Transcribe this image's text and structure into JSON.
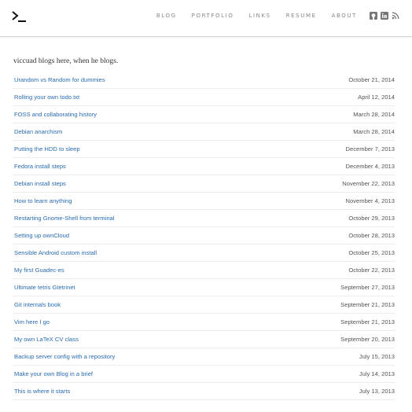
{
  "header": {
    "logo_icon": "terminal-prompt-icon",
    "nav": [
      "BLOG",
      "PORTFOLIO",
      "LINKS",
      "RESUME",
      "ABOUT"
    ],
    "social_icons": [
      "github-icon",
      "linkedin-icon",
      "rss-icon"
    ]
  },
  "intro": "viccuad blogs here, when he blogs.",
  "posts": [
    {
      "title": "Urandom vs Random for dummies",
      "date": "October 21, 2014"
    },
    {
      "title": "Rolling your own todo.txt",
      "date": "April 12, 2014"
    },
    {
      "title": "FOSS and collaborating history",
      "date": "March 28, 2014"
    },
    {
      "title": "Debian anarchism",
      "date": "March 28, 2014"
    },
    {
      "title": "Putting the HDD to sleep",
      "date": "December 7, 2013"
    },
    {
      "title": "Fedora install steps",
      "date": "December 4, 2013"
    },
    {
      "title": "Debian install steps",
      "date": "November 22, 2013"
    },
    {
      "title": "How to learn anything",
      "date": "November 4, 2013"
    },
    {
      "title": "Restarting Gnome-Shell from terminal",
      "date": "October 29, 2013"
    },
    {
      "title": "Setting up ownCloud",
      "date": "October 28, 2013"
    },
    {
      "title": "Sensible Android custom install",
      "date": "October 25, 2013"
    },
    {
      "title": "My first Guadec-es",
      "date": "October 22, 2013"
    },
    {
      "title": "Ultimate tetris Gtetrinet",
      "date": "September 27, 2013"
    },
    {
      "title": "Git internals book",
      "date": "September 21, 2013"
    },
    {
      "title": "Vim here I go",
      "date": "September 21, 2013"
    },
    {
      "title": "My own LaTeX CV class",
      "date": "September 20, 2013"
    },
    {
      "title": "Backup server config with a repository",
      "date": "July 15, 2013"
    },
    {
      "title": "Make your own Blog in a brief",
      "date": "July 14, 2013"
    },
    {
      "title": "This is where it starts",
      "date": "July 13, 2013"
    }
  ]
}
